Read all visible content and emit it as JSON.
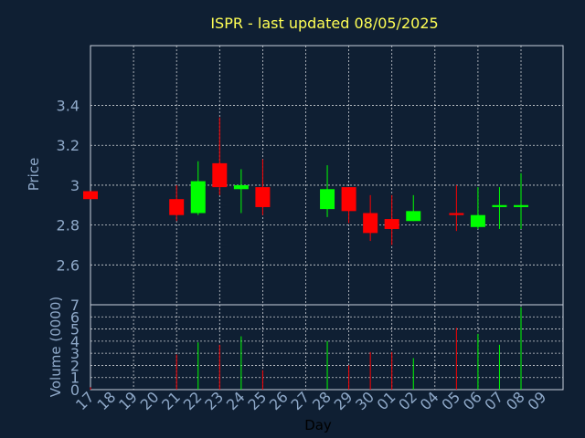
{
  "chart_data": {
    "type": "candlestick",
    "title": "ISPR - last updated 08/05/2025",
    "xlabel": "Day",
    "ylabel_price": "Price",
    "ylabel_volume": "Volume (0000)",
    "x_ticks": [
      "17",
      "18",
      "19",
      "20",
      "21",
      "22",
      "23",
      "24",
      "25",
      "26",
      "27",
      "28",
      "29",
      "30",
      "01",
      "02",
      "04",
      "05",
      "06",
      "07",
      "08",
      "09"
    ],
    "price_ticks": [
      "2.6",
      "2.8",
      "3",
      "3.2",
      "3.4"
    ],
    "price_tick_values": [
      2.6,
      2.8,
      3.0,
      3.2,
      3.4
    ],
    "price_ylim": [
      2.4,
      3.7
    ],
    "volume_ticks": [
      "0",
      "1",
      "2",
      "3",
      "4",
      "5",
      "6",
      "7"
    ],
    "volume_ylim": [
      0,
      7
    ],
    "grid": true,
    "colors": {
      "background": "#0f1f33",
      "up": "#00ff00",
      "down": "#ff0000",
      "grid": "#ffffff",
      "title": "#ffff55",
      "tick": "#8fa9c9"
    },
    "candles": [
      {
        "day": "17",
        "open": 2.97,
        "high": 2.97,
        "low": 2.93,
        "close": 2.93,
        "volume": 0.2
      },
      {
        "day": "21",
        "open": 2.93,
        "high": 3.0,
        "low": 2.82,
        "close": 2.85,
        "volume": 2.9
      },
      {
        "day": "22",
        "open": 2.86,
        "high": 3.12,
        "low": 2.85,
        "close": 3.02,
        "volume": 3.9
      },
      {
        "day": "23",
        "open": 3.11,
        "high": 3.34,
        "low": 2.95,
        "close": 2.99,
        "volume": 3.7
      },
      {
        "day": "24",
        "open": 2.98,
        "high": 3.08,
        "low": 2.86,
        "close": 3.0,
        "volume": 4.4
      },
      {
        "day": "25",
        "open": 2.99,
        "high": 3.13,
        "low": 2.85,
        "close": 2.89,
        "volume": 1.6
      },
      {
        "day": "28",
        "open": 2.88,
        "high": 3.1,
        "low": 2.84,
        "close": 2.98,
        "volume": 4.0
      },
      {
        "day": "29",
        "open": 2.99,
        "high": 2.99,
        "low": 2.81,
        "close": 2.87,
        "volume": 2.0
      },
      {
        "day": "30",
        "open": 2.86,
        "high": 2.95,
        "low": 2.72,
        "close": 2.76,
        "volume": 3.1
      },
      {
        "day": "01",
        "open": 2.83,
        "high": 2.95,
        "low": 2.7,
        "close": 2.78,
        "volume": 3.1
      },
      {
        "day": "02",
        "open": 2.82,
        "high": 2.95,
        "low": 2.82,
        "close": 2.87,
        "volume": 2.6
      },
      {
        "day": "05",
        "open": 2.86,
        "high": 3.0,
        "low": 2.77,
        "close": 2.85,
        "volume": 5.1
      },
      {
        "day": "06",
        "open": 2.79,
        "high": 2.99,
        "low": 2.78,
        "close": 2.85,
        "volume": 4.6
      },
      {
        "day": "07",
        "open": 2.89,
        "high": 2.99,
        "low": 2.78,
        "close": 2.9,
        "volume": 3.7
      },
      {
        "day": "08",
        "open": 2.89,
        "high": 3.06,
        "low": 2.78,
        "close": 2.9,
        "volume": 6.8
      }
    ]
  }
}
